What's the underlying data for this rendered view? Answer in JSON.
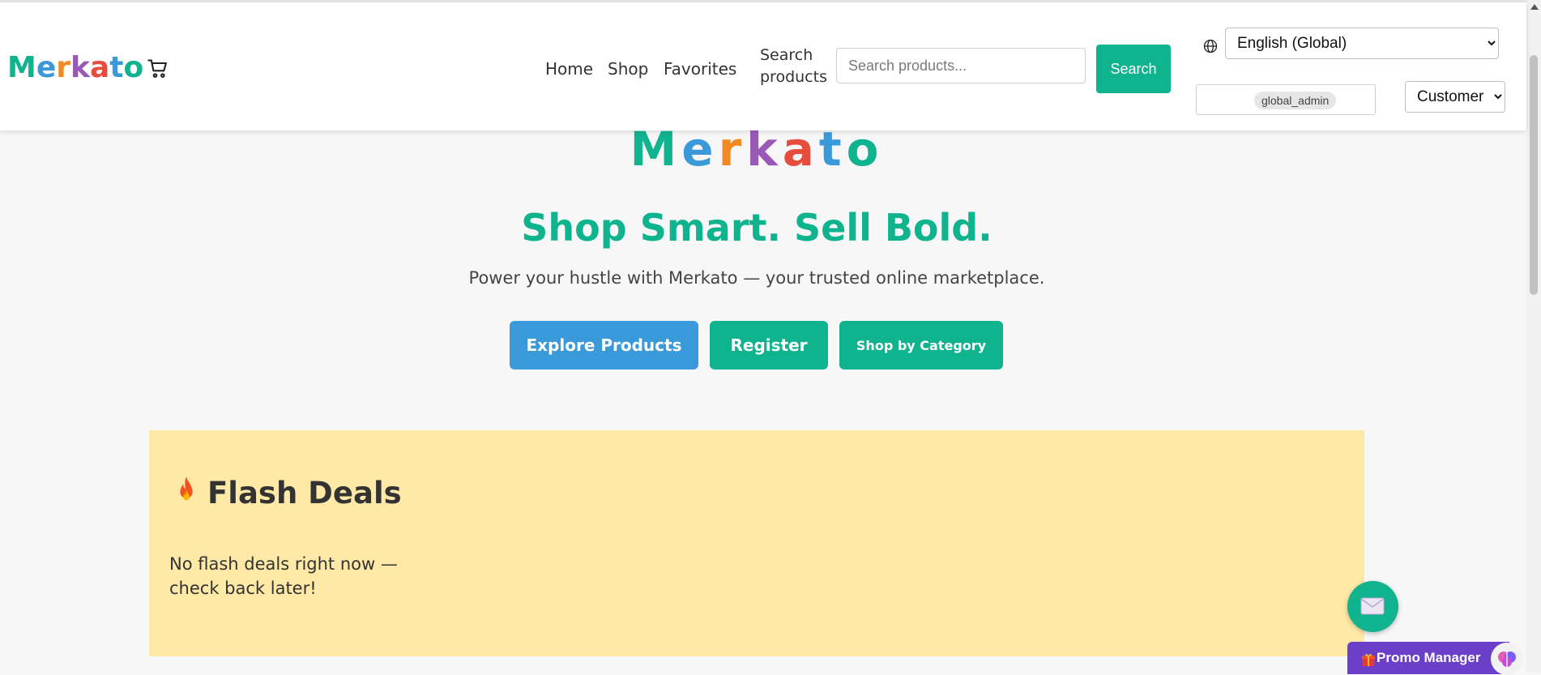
{
  "header": {
    "logo": [
      "M",
      "e",
      "r",
      "k",
      "a",
      "t",
      "o"
    ],
    "nav": {
      "home": "Home",
      "shop": "Shop",
      "favorites": "Favorites"
    },
    "search": {
      "label_line1": "Search",
      "label_line2": "products",
      "placeholder": "Search products...",
      "button": "Search"
    },
    "language": {
      "selected": "English (Global)"
    },
    "user": {
      "name": "global_admin"
    },
    "role": {
      "selected": "Customer"
    }
  },
  "hero": {
    "logo": [
      "M",
      "e",
      "r",
      "k",
      "a",
      "t",
      "o"
    ],
    "title": "Shop Smart. Sell Bold.",
    "subtitle": "Power your hustle with Merkato — your trusted online marketplace.",
    "buttons": {
      "explore": "Explore Products",
      "register": "Register",
      "category": "Shop by Category"
    }
  },
  "flash": {
    "title": "Flash Deals",
    "empty_message": "No flash deals right now — check back later!"
  },
  "floating": {
    "promo": "Promo Manager"
  },
  "colors": {
    "primary": "#0fb38e",
    "secondary": "#3a9ad9",
    "logo_letters": [
      "#0fb38e",
      "#3a9ad9",
      "#f08a24",
      "#9b59b6",
      "#e74c3c",
      "#3a9ad9",
      "#0fb38e"
    ],
    "flash_bg": "#fee9a6",
    "promo": "#6c3fc9"
  },
  "icons": {
    "cart": "cart-icon",
    "globe": "globe-icon",
    "flame": "flame-icon",
    "chat": "envelope-icon",
    "gift": "gift-icon",
    "brain": "brain-icon"
  }
}
